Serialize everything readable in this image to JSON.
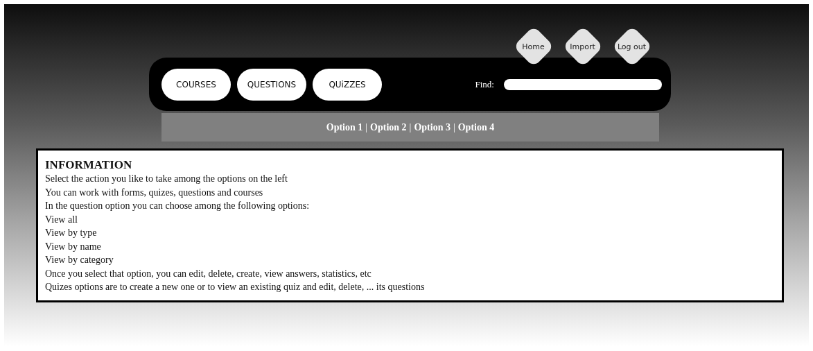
{
  "top_links": [
    "Home",
    "Import",
    "Log out"
  ],
  "tabs": [
    "COURSES",
    "QUESTIONS",
    "QUiZZES"
  ],
  "search": {
    "label": "Find:"
  },
  "sub_menu": {
    "separator": "|",
    "options": [
      "Option 1",
      "Option 2",
      "Option 3",
      "Option 4"
    ]
  },
  "info": {
    "title": "INFORMATION",
    "lines": [
      "Select the action you like to take among the options on the left",
      "You can work with forms, quizes, questions and courses",
      "In the question option you can choose among the following options:",
      "View all",
      "View by type",
      "View by name",
      "View by category",
      "Once you select that option, you can edit, delete, create, view answers, statistics, etc",
      "Quizes options are to create a new one or to view an existing quiz and edit, delete, ... its questions"
    ]
  }
}
